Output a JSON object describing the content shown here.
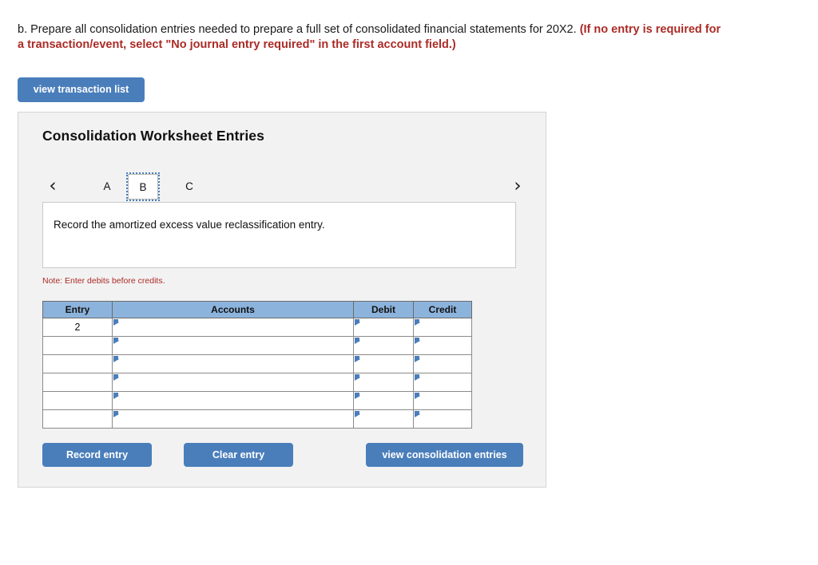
{
  "question": {
    "main_text": "b. Prepare all consolidation entries needed to prepare a full set of consolidated financial statements for 20X2.",
    "emphasis_text": "(If no entry is required for a transaction/event, select \"No journal entry required\" in the first account field.)"
  },
  "top_actions": {
    "view_transaction_list_label": "view transaction list"
  },
  "panel": {
    "title": "Consolidation Worksheet Entries",
    "tabs": {
      "prev_arrow": "‹",
      "next_arrow": "›",
      "items": [
        {
          "label": "A",
          "selected": false
        },
        {
          "label": "B",
          "selected": true
        },
        {
          "label": "C",
          "selected": false
        }
      ]
    },
    "instruction": "Record the amortized excess value reclassification entry.",
    "note": "Note: Enter debits before credits.",
    "table": {
      "headers": [
        "Entry",
        "Accounts",
        "Debit",
        "Credit"
      ],
      "rows": [
        {
          "entry": "2",
          "accounts": "",
          "debit": "",
          "credit": ""
        },
        {
          "entry": "",
          "accounts": "",
          "debit": "",
          "credit": ""
        },
        {
          "entry": "",
          "accounts": "",
          "debit": "",
          "credit": ""
        },
        {
          "entry": "",
          "accounts": "",
          "debit": "",
          "credit": ""
        },
        {
          "entry": "",
          "accounts": "",
          "debit": "",
          "credit": ""
        },
        {
          "entry": "",
          "accounts": "",
          "debit": "",
          "credit": ""
        }
      ]
    },
    "buttons": {
      "record_entry_label": "Record entry",
      "clear_entry_label": "Clear entry",
      "view_consolidation_entries_label": "view consolidation entries"
    }
  },
  "colors": {
    "accent_blue": "#4a7ebb",
    "table_header_blue": "#8cb3dc",
    "alert_red": "#ab2b26",
    "panel_background": "#f2f2f2"
  }
}
